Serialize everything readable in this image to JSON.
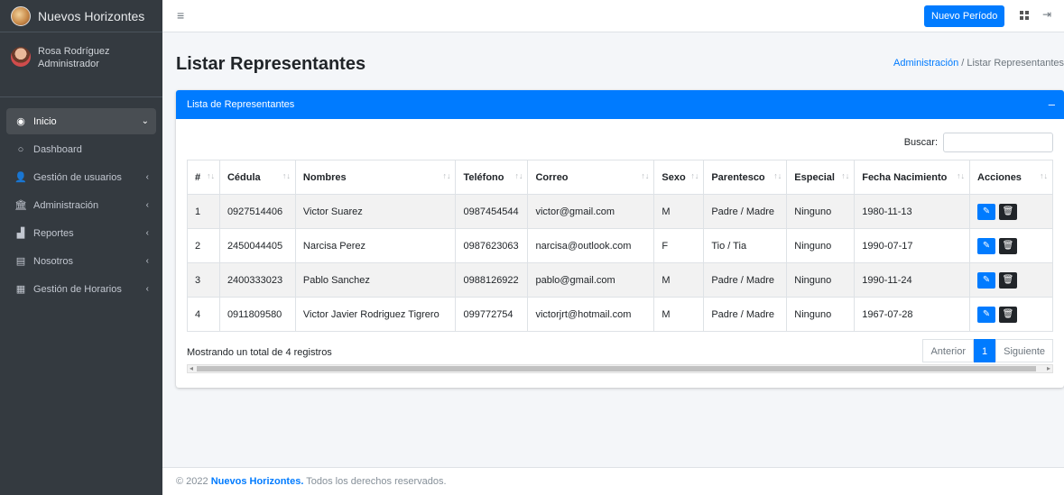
{
  "brand": {
    "name": "Nuevos Horizontes"
  },
  "user": {
    "name": "Rosa Rodríguez",
    "role": "Administrador"
  },
  "sidebar": {
    "items": [
      {
        "icon": "tachometer-icon",
        "glyph": "◉",
        "label": "Inicio",
        "caret": "⌄"
      },
      {
        "icon": "circle-icon",
        "glyph": "○",
        "label": "Dashboard",
        "caret": ""
      },
      {
        "icon": "user-icon",
        "glyph": "👤",
        "label": "Gestión de usuarios",
        "caret": "‹"
      },
      {
        "icon": "institution-icon",
        "glyph": "🏛",
        "label": "Administración",
        "caret": "‹"
      },
      {
        "icon": "chart-icon",
        "glyph": "▟",
        "label": "Reportes",
        "caret": "‹"
      },
      {
        "icon": "book-icon",
        "glyph": "▤",
        "label": "Nosotros",
        "caret": "‹"
      },
      {
        "icon": "calendar-icon",
        "glyph": "▦",
        "label": "Gestión de Horarios",
        "caret": "‹"
      }
    ]
  },
  "topbar": {
    "nuevo_periodo": "Nuevo Período"
  },
  "header": {
    "title": "Listar Representantes",
    "breadcrumb_link": "Administración",
    "breadcrumb_sep": "/",
    "breadcrumb_current": "Listar Representantes"
  },
  "card": {
    "title": "Lista de Representantes",
    "collapse": "–",
    "search_label": "Buscar:",
    "search_value": ""
  },
  "table": {
    "headers": [
      "#",
      "Cédula",
      "Nombres",
      "Teléfono",
      "Correo",
      "Sexo",
      "Parentesco",
      "Especial",
      "Fecha Nacimiento",
      "Acciones"
    ],
    "rows": [
      [
        "1",
        "0927514406",
        "Victor Suarez",
        "0987454544",
        "victor@gmail.com",
        "M",
        "Padre / Madre",
        "Ninguno",
        "1980-11-13"
      ],
      [
        "2",
        "2450044405",
        "Narcisa Perez",
        "0987623063",
        "narcisa@outlook.com",
        "F",
        "Tio / Tia",
        "Ninguno",
        "1990-07-17"
      ],
      [
        "3",
        "2400333023",
        "Pablo Sanchez",
        "0988126922",
        "pablo@gmail.com",
        "M",
        "Padre / Madre",
        "Ninguno",
        "1990-11-24"
      ],
      [
        "4",
        "0911809580",
        "Victor Javier Rodriguez Tigrero",
        "099772754",
        "victorjrt@hotmail.com",
        "M",
        "Padre / Madre",
        "Ninguno",
        "1967-07-28"
      ]
    ]
  },
  "pagination": {
    "info": "Mostrando un total de 4 registros",
    "prev": "Anterior",
    "current": "1",
    "next": "Siguiente"
  },
  "footer": {
    "copyright": "© 2022",
    "brand": "Nuevos Horizontes.",
    "rights": "Todos los derechos reservados."
  },
  "colors": {
    "primary": "#007bff",
    "sidebar": "#343a40",
    "danger_dark": "#212529"
  }
}
